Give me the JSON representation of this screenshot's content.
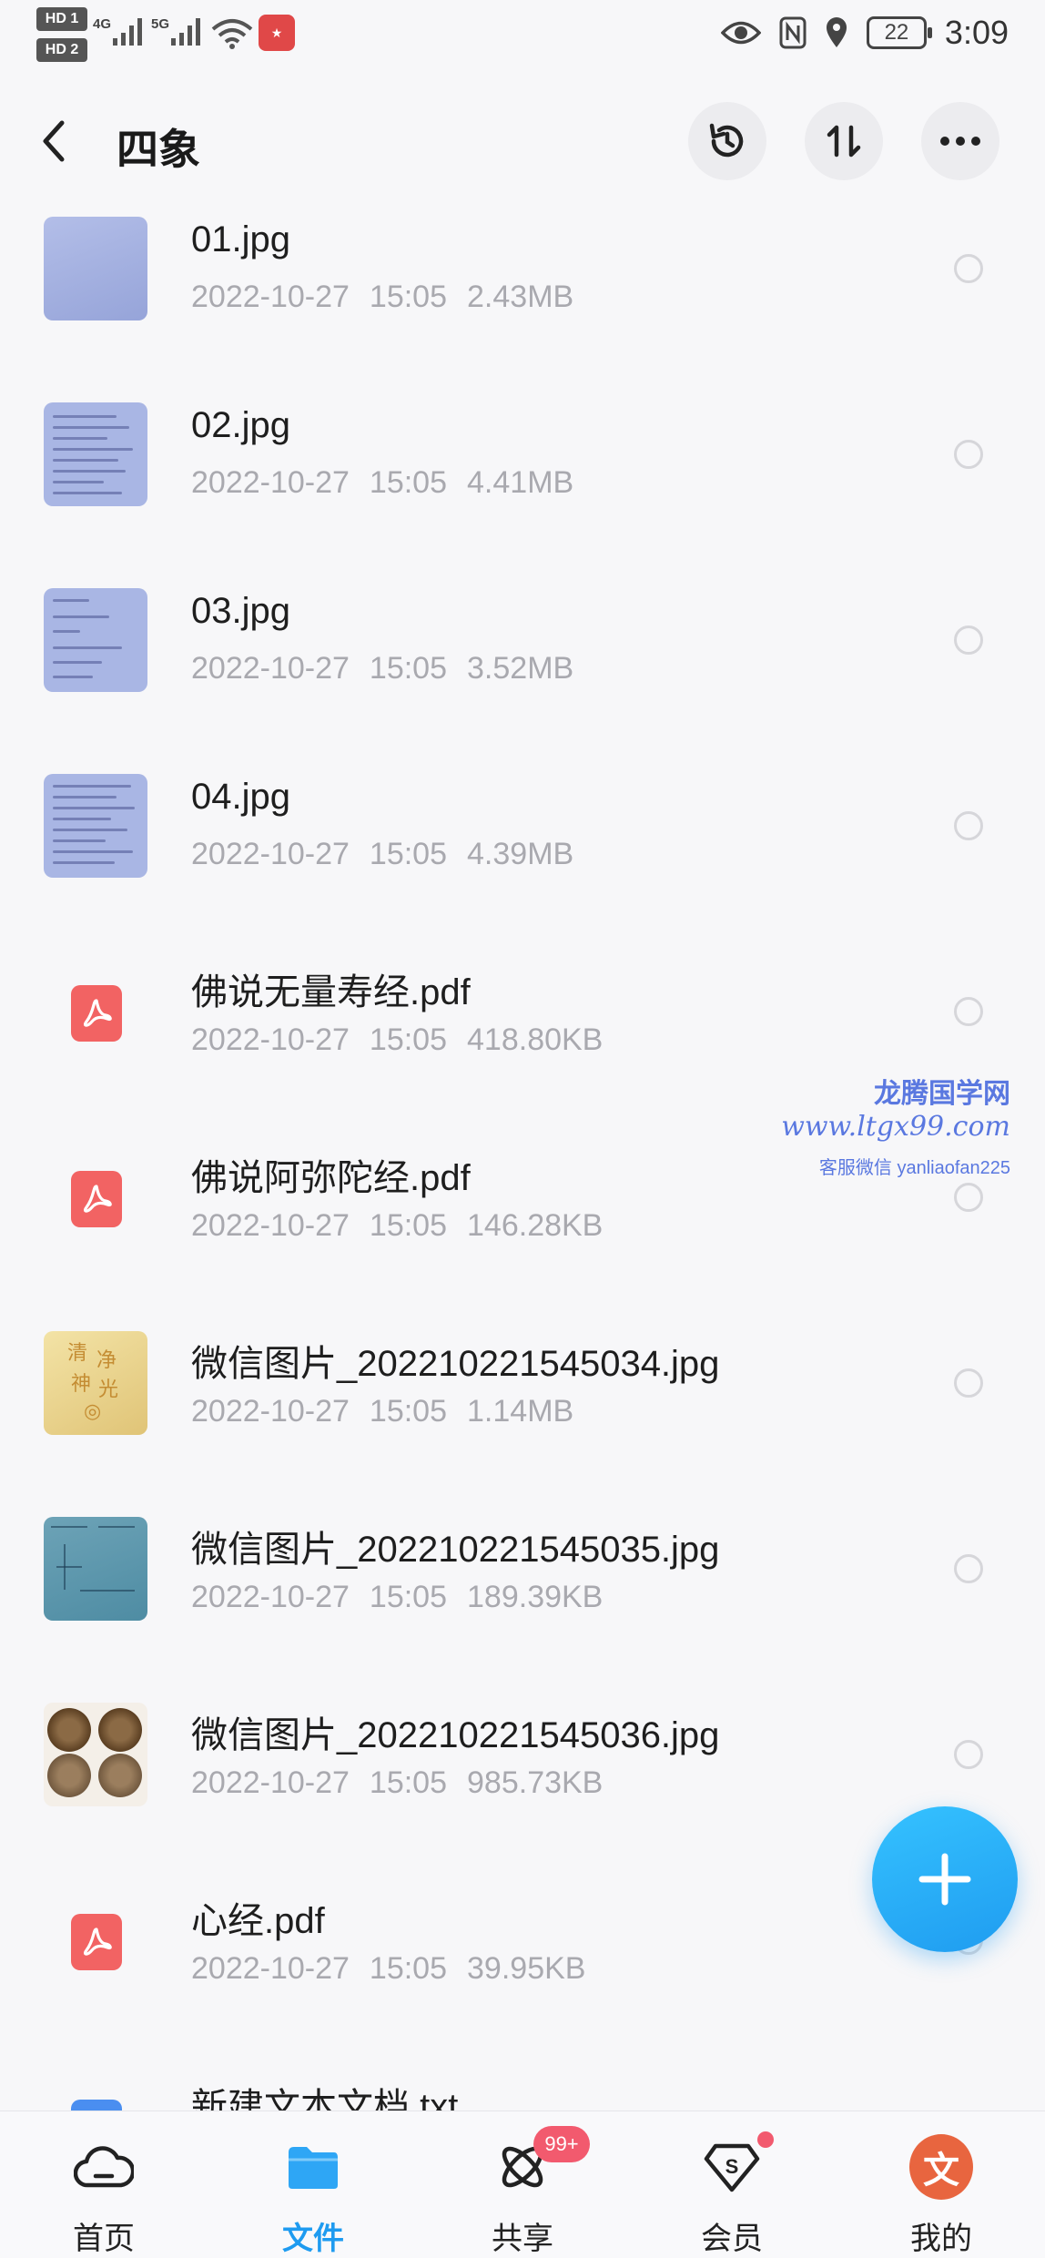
{
  "status_bar": {
    "sim1": "HD 1",
    "sim2": "HD 2",
    "net1": "4G",
    "net2": "5G",
    "battery": "22",
    "time": "3:09"
  },
  "header": {
    "title": "四象"
  },
  "files": [
    {
      "name": "01.jpg",
      "date": "2022-10-27",
      "time": "15:05",
      "size": "2.43MB",
      "thumb": "photo"
    },
    {
      "name": "02.jpg",
      "date": "2022-10-27",
      "time": "15:05",
      "size": "4.41MB",
      "thumb": "document"
    },
    {
      "name": "03.jpg",
      "date": "2022-10-27",
      "time": "15:05",
      "size": "3.52MB",
      "thumb": "document"
    },
    {
      "name": "04.jpg",
      "date": "2022-10-27",
      "time": "15:05",
      "size": "4.39MB",
      "thumb": "document"
    },
    {
      "name": "佛说无量寿经.pdf",
      "date": "2022-10-27",
      "time": "15:05",
      "size": "418.80KB",
      "thumb": "pdf-icon"
    },
    {
      "name": "佛说阿弥陀经.pdf",
      "date": "2022-10-27",
      "time": "15:05",
      "size": "146.28KB",
      "thumb": "pdf-icon"
    },
    {
      "name": "微信图片_202210221545034.jpg",
      "date": "2022-10-27",
      "time": "15:05",
      "size": "1.14MB",
      "thumb": "calligraphy"
    },
    {
      "name": "微信图片_202210221545035.jpg",
      "date": "2022-10-27",
      "time": "15:05",
      "size": "189.39KB",
      "thumb": "sketch"
    },
    {
      "name": "微信图片_202210221545036.jpg",
      "date": "2022-10-27",
      "time": "15:05",
      "size": "985.73KB",
      "thumb": "coins"
    },
    {
      "name": "心经.pdf",
      "date": "2022-10-27",
      "time": "15:05",
      "size": "39.95KB",
      "thumb": "pdf-icon"
    },
    {
      "name": "新建文本文档.txt",
      "date": "",
      "time": "",
      "size": "",
      "thumb": "txt-icon"
    }
  ],
  "watermark": {
    "line1": "龙腾国学网",
    "line2": "www.ltgx99.com",
    "line3": "客服微信 yanliaofan225"
  },
  "nav": {
    "items": [
      {
        "label": "首页",
        "icon": "cloud-icon"
      },
      {
        "label": "文件",
        "icon": "folder-icon"
      },
      {
        "label": "共享",
        "icon": "share-atom-icon",
        "badge": "99+"
      },
      {
        "label": "会员",
        "icon": "vip-diamond-icon"
      },
      {
        "label": "我的",
        "icon": "avatar"
      }
    ]
  },
  "colors": {
    "accent": "#1E9BF0",
    "pdf": "#F26363",
    "badge": "#F25A6E",
    "meta_text": "#A9A9AF"
  }
}
